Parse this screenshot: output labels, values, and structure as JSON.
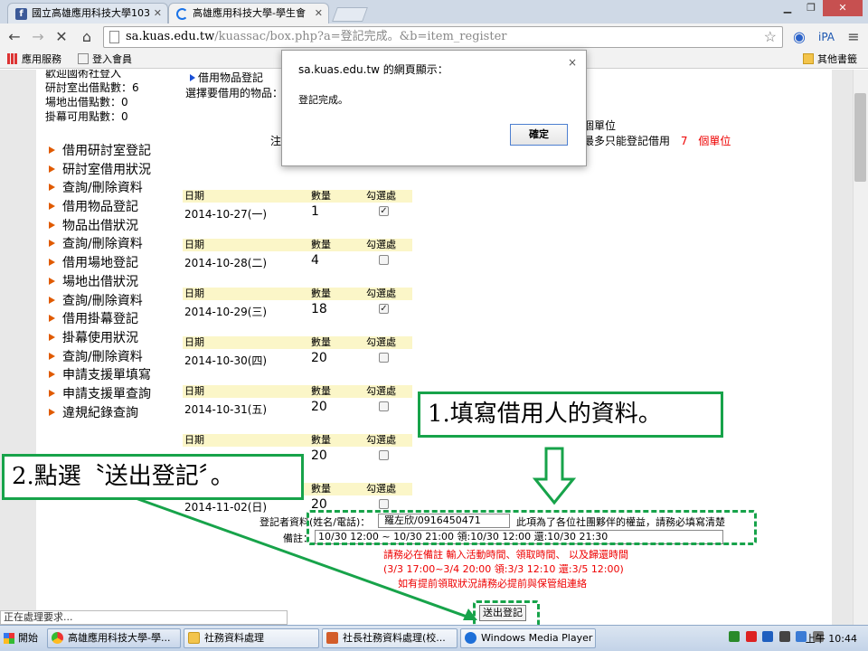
{
  "browser": {
    "tab_inactive_title": "國立高雄應用科技大學103",
    "tab_active_title": "高雄應用科技大學-學生會",
    "url_host": "sa.kuas.edu.tw",
    "url_path": "/kuassac/box.php?a=登記完成。&b=item_register",
    "bookmarks": {
      "apps": "應用服務",
      "login": "登入會員",
      "other": "其他書籤"
    },
    "status_text": "正在處理要求..."
  },
  "page": {
    "sidebar_top": [
      "歡迎國術社登入",
      "研討室出借點數：6",
      "場地出借點數：0",
      "掛幕可用點數：0"
    ],
    "nav_items": [
      "借用研討室登記",
      "研討室借用狀況",
      "查詢/刪除資料",
      "借用物品登記",
      "物品出借狀況",
      "查詢/刪除資料",
      "借用場地登記",
      "場地出借狀況",
      "查詢/刪除資料",
      "借用掛幕登記",
      "掛幕使用狀況",
      "查詢/刪除資料",
      "申請支援單填寫",
      "申請支援單查詢",
      "違規紀錄查詢"
    ],
    "section_title": "借用物品登記",
    "choose_label": "選擇要借用的物品：",
    "unit_text": "個單位",
    "note_left": "注",
    "note_right_pre": "最多只能登記借用",
    "note_right_num": "7",
    "note_right_post": "個單位",
    "col_headers": {
      "date": "日期",
      "qty": "數量",
      "check": "勾選處"
    },
    "days": [
      {
        "date": "2014-10-27(一)",
        "qty": "1",
        "checked": true
      },
      {
        "date": "2014-10-28(二)",
        "qty": "4",
        "checked": false
      },
      {
        "date": "2014-10-29(三)",
        "qty": "18",
        "checked": true
      },
      {
        "date": "2014-10-30(四)",
        "qty": "20",
        "checked": false
      },
      {
        "date": "2014-10-31(五)",
        "qty": "20",
        "checked": false
      },
      {
        "date": "",
        "qty": "20",
        "checked": false
      },
      {
        "date": "2014-11-02(日)",
        "qty": "20",
        "checked": false
      }
    ],
    "registrant_label": "登記者資料(姓名/電話)：",
    "registrant_value": "羅左欣/0916450471",
    "registrant_hint": "此項為了各位社團夥伴的權益，請務必填寫清楚",
    "remark_label": "備註：",
    "remark_value": "10/30 12:00 ~ 10/30 21:00 領:10/30 12:00 還:10/30 21:30",
    "red_lines": [
      "請務必在備註 輸入活動時間、領取時間、 以及歸還時間",
      "(3/3 17:00~3/4 20:00 領:3/3 12:10 還:3/5 12:00)",
      "如有提前領取狀況請務必提前與保管組連絡"
    ],
    "submit_label": "送出登記"
  },
  "dialog": {
    "title": "sa.kuas.edu.tw 的網頁顯示：",
    "message": "登記完成。",
    "ok_label": "確定",
    "close_glyph": "×"
  },
  "annotations": {
    "step1": "1.填寫借用人的資料。",
    "step2": "2.點選〝送出登記〞。",
    "color": "#17a34a"
  },
  "taskbar": {
    "start": "開始",
    "items": [
      "高雄應用科技大學-學...",
      "社務資料處理",
      "社長社務資料處理(校...",
      "Windows Media Player"
    ],
    "clock": "上午 10:44"
  }
}
